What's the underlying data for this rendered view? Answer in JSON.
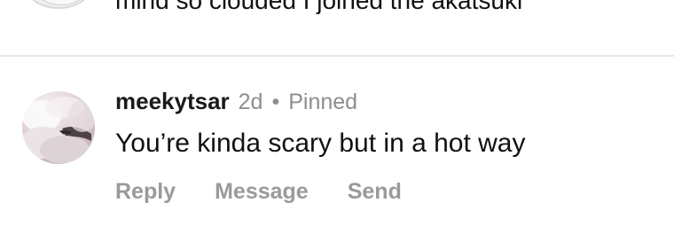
{
  "previous_comment": {
    "text": "mind so clouded I joined the akatsuki"
  },
  "comment": {
    "username": "meekytsar",
    "time": "2d",
    "separator": "•",
    "status": "Pinned",
    "text": "You’re kinda scary but in a hot way",
    "avatar_icon": "profile-photo",
    "actions": {
      "reply": "Reply",
      "message": "Message",
      "send": "Send"
    }
  },
  "colors": {
    "background": "#ffffff",
    "muted_text": "#8e8e8e",
    "action_text": "#9a9a9a",
    "divider": "#e6e6e6"
  }
}
